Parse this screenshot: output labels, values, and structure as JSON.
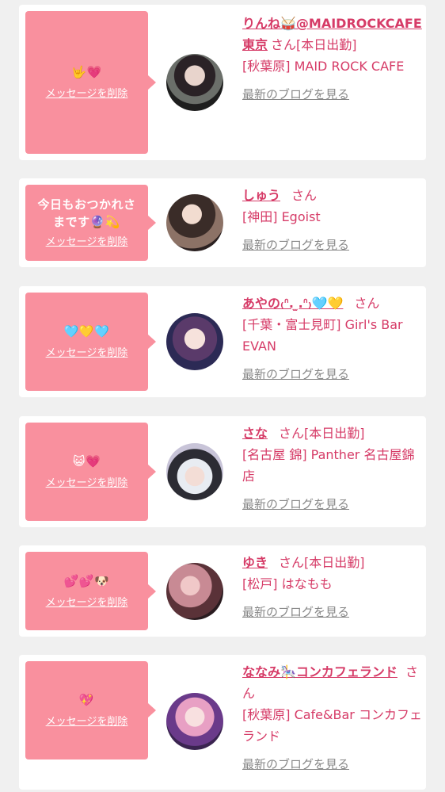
{
  "delete_label": "メッセージを削除",
  "blog_label": "最新のブログを見る",
  "cards": [
    {
      "message": "🤟💗",
      "name": "りんね🥁@MAIDROCKCAFE東京",
      "suffix": "さん",
      "status": "[本日出勤]",
      "store": "[秋葉原] MAID ROCK CAFE"
    },
    {
      "message": "今日もおつかれさまです🔮💫",
      "name": "しゅう",
      "suffix": "さん",
      "status": "",
      "store": "[神田] Egoist"
    },
    {
      "message": "🩵💛🩵",
      "name": "あやの₍ᐢ. ̫.ᐢ₎🩵💛",
      "suffix": "さん",
      "status": "",
      "store": "[千葉・富士見町] Girl's Bar EVAN"
    },
    {
      "message": "😺💗",
      "name": "さな",
      "suffix": "さん",
      "status": "[本日出勤]",
      "store": "[名古屋 錦] Panther 名古屋錦店"
    },
    {
      "message": "💕💕🐶",
      "name": "ゆき",
      "suffix": "さん",
      "status": "[本日出勤]",
      "store": "[松戸] はなもも"
    },
    {
      "message": "💖",
      "name": "ななみ🎠コンカフェランド",
      "suffix": "さん",
      "status": "",
      "store": "[秋葉原] Cafe&Bar コンカフェランド"
    }
  ],
  "colors": {
    "bubble": "#f9909e",
    "accent": "#d63b67",
    "link_gray": "#888888",
    "background": "#f0f0f0"
  }
}
